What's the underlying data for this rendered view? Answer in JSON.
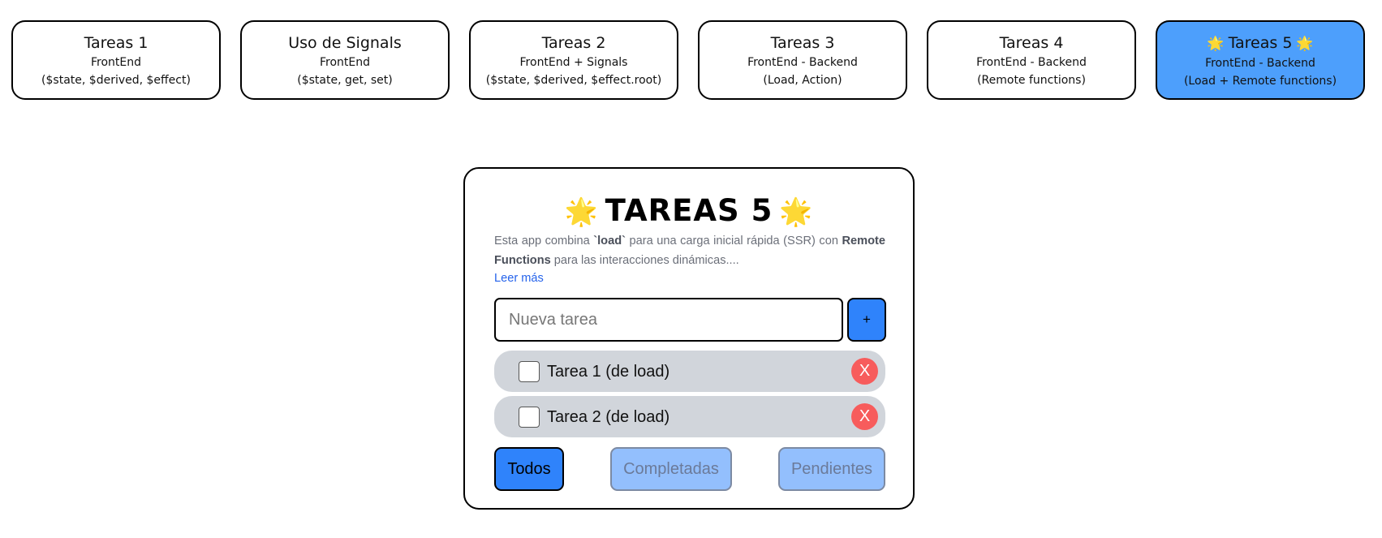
{
  "nav": {
    "cards": [
      {
        "title": "Tareas 1",
        "line1": "FrontEnd",
        "line2": "($state, $derived, $effect)"
      },
      {
        "title": "Uso de Signals",
        "line1": "FrontEnd",
        "line2": "($state, get, set)"
      },
      {
        "title": "Tareas 2",
        "line1": "FrontEnd + Signals",
        "line2": "($state, $derived, $effect.root)"
      },
      {
        "title": "Tareas 3",
        "line1": "FrontEnd - Backend",
        "line2": "(Load, Action)"
      },
      {
        "title": "Tareas 4",
        "line1": "FrontEnd - Backend",
        "line2": "(Remote functions)"
      },
      {
        "title": "Tareas 5",
        "line1": "FrontEnd - Backend",
        "line2": "(Load + Remote functions)",
        "active": true,
        "emoji": "🌟"
      }
    ]
  },
  "panel": {
    "emoji": "🌟",
    "title": "TAREAS 5",
    "desc_part1": "Esta app combina ",
    "desc_load": "`load`",
    "desc_part2": " para una carga inicial rápida (SSR) con ",
    "desc_remote": "Remote Functions",
    "desc_part3": " para las interacciones dinámicas....",
    "read_more": "Leer más",
    "input_placeholder": "Nueva tarea",
    "add_label": "+",
    "tasks": [
      {
        "label": "Tarea 1 (de load)",
        "checked": false,
        "delete": "X"
      },
      {
        "label": "Tarea 2 (de load)",
        "checked": false,
        "delete": "X"
      }
    ],
    "filters": {
      "all": "Todos",
      "done": "Completadas",
      "pending": "Pendientes",
      "selected": "Todos"
    }
  },
  "colors": {
    "accent": "#2f83fb",
    "active_card": "#4d9ffc",
    "task_bg": "#d1d5db",
    "delete": "#f75c5c",
    "link": "#2563eb"
  }
}
